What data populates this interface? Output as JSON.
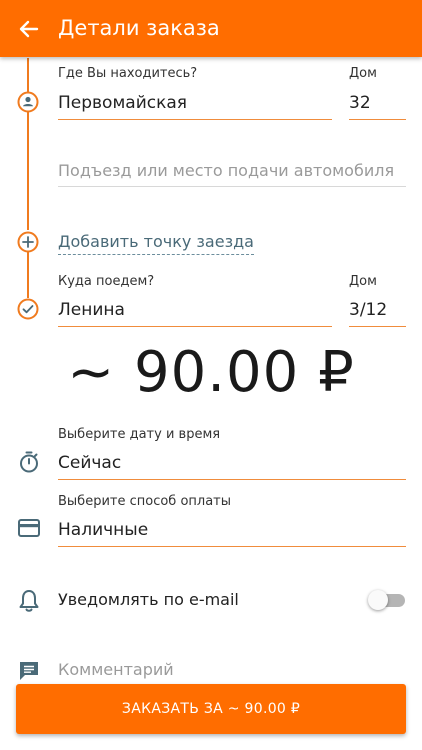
{
  "header": {
    "title": "Детали заказа",
    "back_icon": "arrow-left-icon"
  },
  "from": {
    "label": "Где Вы находитесь?",
    "street": "Первомайская",
    "house_label": "Дом",
    "house": "32",
    "entrance_placeholder": "Подъезд или место подачи автомобиля"
  },
  "add_stop": {
    "label": "Добавить точку заезда"
  },
  "to": {
    "label": "Куда поедем?",
    "street": "Ленина",
    "house_label": "Дом",
    "house": "3/12"
  },
  "price": {
    "text": "~ 90.00 ₽"
  },
  "datetime": {
    "label": "Выберите дату и время",
    "value": "Сейчас"
  },
  "payment": {
    "label": "Выберите способ оплаты",
    "value": "Наличные"
  },
  "email_notify": {
    "label": "Уведомлять по e-mail",
    "enabled": false
  },
  "comment": {
    "placeholder": "Комментарий"
  },
  "order_button": {
    "label": "ЗАКАЗАТЬ ЗА ~ 90.00 ₽"
  },
  "colors": {
    "accent": "#ff6d00",
    "route": "#f07b1f",
    "icon": "#4a6a78"
  }
}
